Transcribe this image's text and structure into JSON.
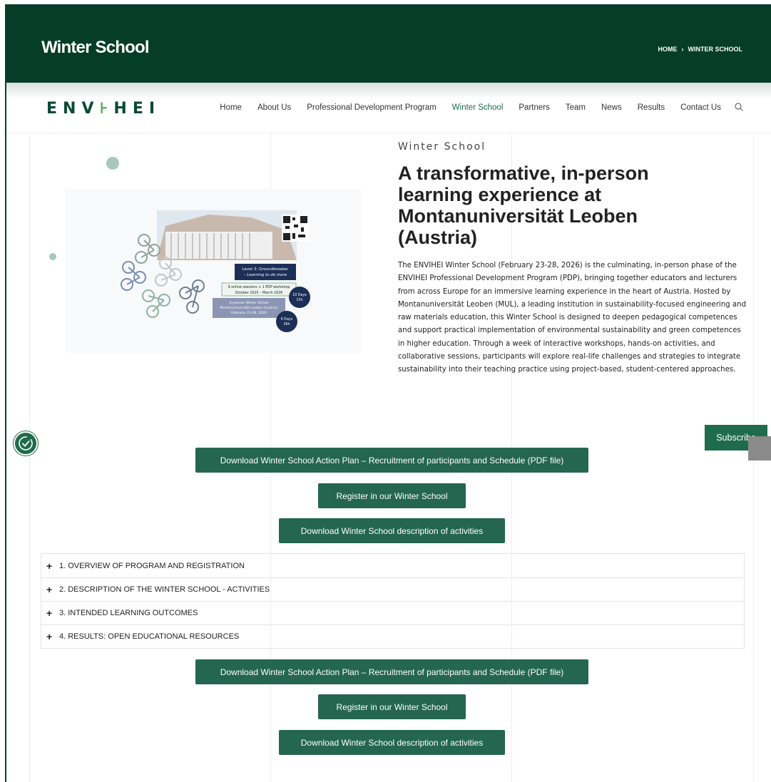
{
  "banner": {
    "title": "Winter School",
    "breadcrumb": {
      "home": "HOME",
      "separator": "›",
      "current": "WINTER SCHOOL"
    }
  },
  "nav": {
    "logo": {
      "prefix": "ENV",
      "leaf": "⊦",
      "suffix": "HEI"
    },
    "items": [
      {
        "label": "Home",
        "active": false
      },
      {
        "label": "About Us",
        "active": false
      },
      {
        "label": "Professional Development Program",
        "active": false
      },
      {
        "label": "Winter School",
        "active": true
      },
      {
        "label": "Partners",
        "active": false
      },
      {
        "label": "Team",
        "active": false
      },
      {
        "label": "News",
        "active": false
      },
      {
        "label": "Results",
        "active": false
      },
      {
        "label": "Contact Us",
        "active": false
      }
    ],
    "search_icon": "search-icon"
  },
  "hero": {
    "eyebrow": "Winter School",
    "title": "A transformative, in-person learning experience at Montanuniversität Leoben (Austria)",
    "body": "The ENVIHEI Winter School (February 23-28, 2026) is the culminating, in-person phase of the ENVIHEI Professional Development Program (PDP), bringing together educators and lecturers from across Europe for an immersive learning experience in the heart of Austria. Hosted by Montanuniversität Leoben (MUL), a leading institution in sustainability-focused engineering and raw materials education, this Winter School is designed to deepen pedagogical competences and support practical implementation of environmental sustainability and green competences in higher education. Through a week of interactive workshops, hands-on activities, and collaborative sessions, participants will explore real-life challenges and strategies to integrate sustainability into their teaching practice using project-based, student-centered approaches.",
    "image": {
      "level_title": "Level 3: Groundbreaker",
      "level_subtitle": "– Learning to do more",
      "sessions_line1": "9 online sessions + 1 PDP workshop",
      "sessions_line2": "October 2025 – March 2026",
      "badge1_line1": "10 Days",
      "badge1_line2": "15h",
      "inperson_line1": "In-person Winter School",
      "inperson_line2": "Montanuniversität Leoben (Austria)",
      "inperson_line3": "February 23-28, 2026",
      "badge2_line1": "6 Days",
      "badge2_line2": "36h"
    }
  },
  "widgets": {
    "subscribe": "Subscribe",
    "accessibility_icon": "accessibility-icon"
  },
  "buttons": {
    "action_plan": "Download Winter School Action Plan – Recruitment of participants and Schedule (PDF file)",
    "register": "Register in our Winter School",
    "description": "Download Winter School description of activities"
  },
  "accordion": [
    {
      "label": "1. OVERVIEW OF PROGRAM AND REGISTRATION"
    },
    {
      "label": "2. DESCRIPTION OF THE WINTER SCHOOL - ACTIVITIES"
    },
    {
      "label": "3. INTENDED LEARNING OUTCOMES"
    },
    {
      "label": "4. RESULTS: OPEN EDUCATIONAL RESOURCES"
    }
  ],
  "colors": {
    "banner": "#053d28",
    "accent": "#1f6b4e",
    "button": "#246650"
  }
}
